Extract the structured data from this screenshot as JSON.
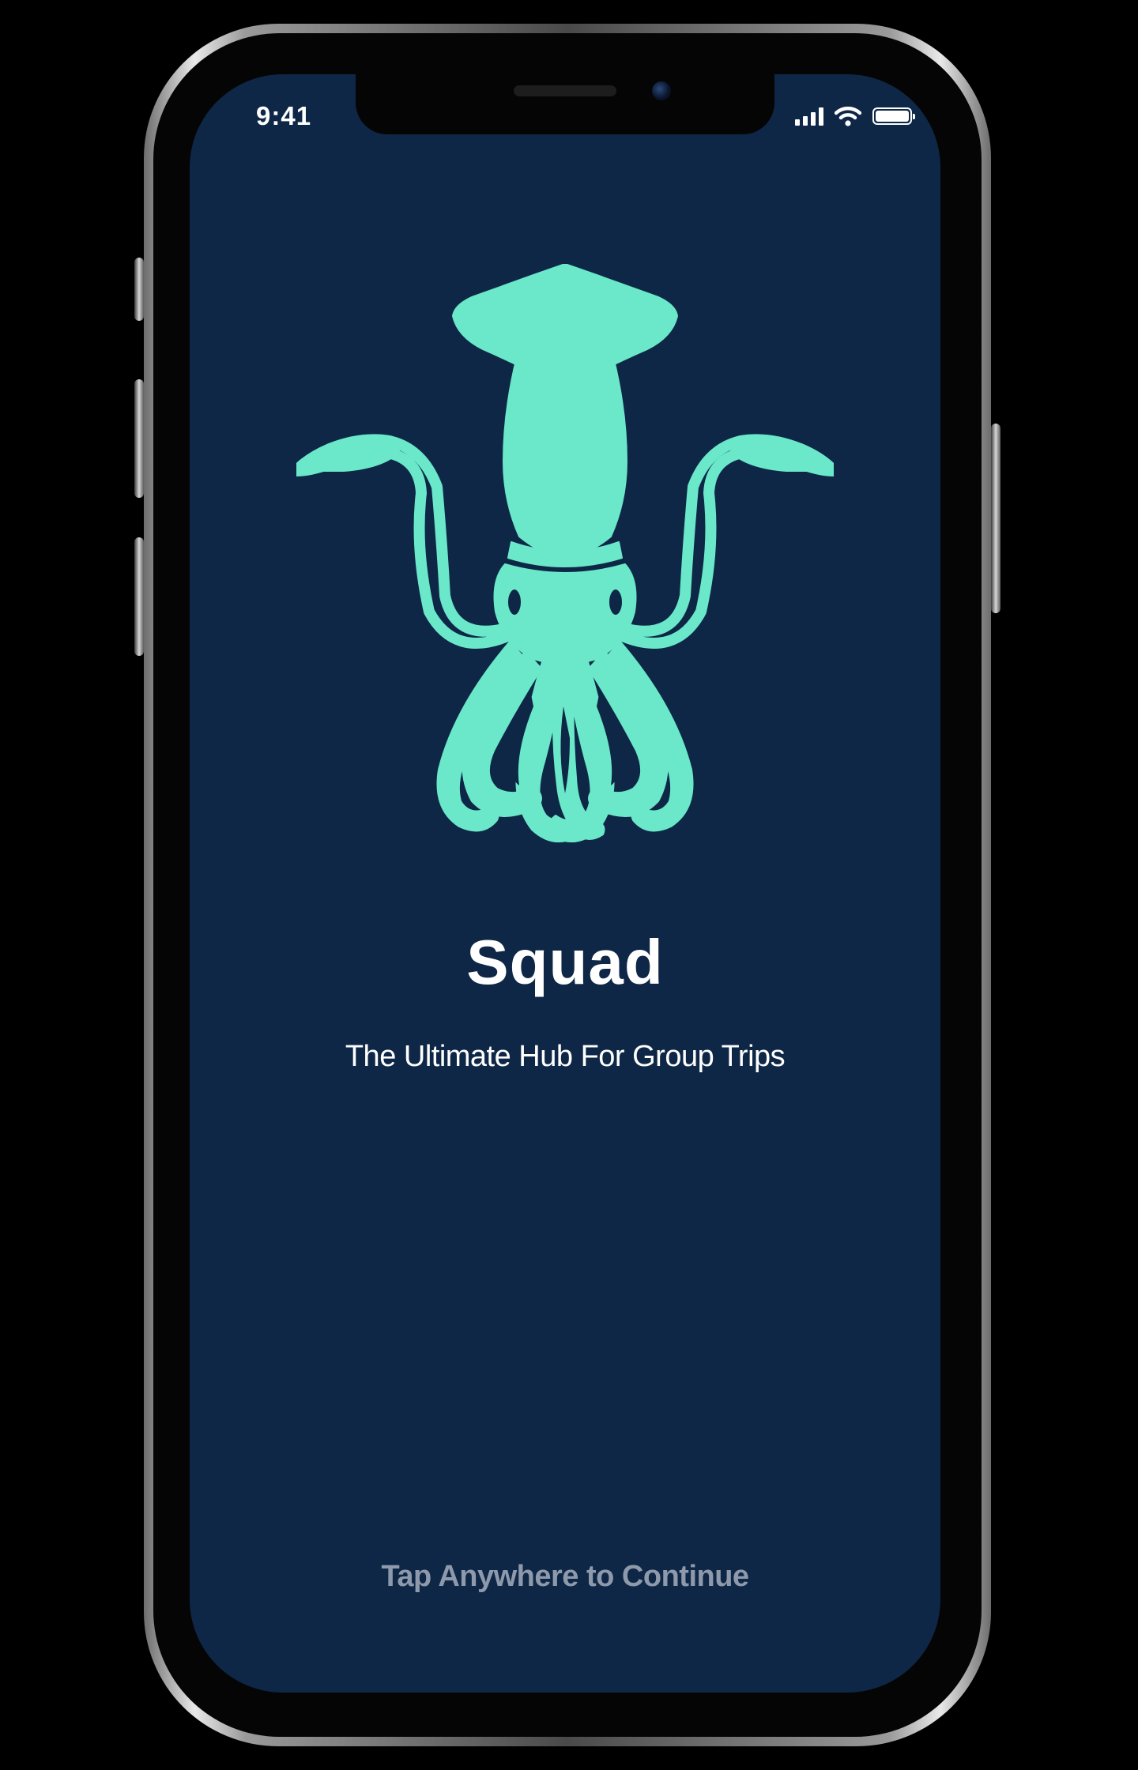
{
  "status_bar": {
    "time": "9:41",
    "signal_bars": 4,
    "battery_level": 1.0
  },
  "app": {
    "title": "Squad",
    "subtitle": "The Ultimate Hub For Group Trips",
    "tap_prompt": "Tap Anywhere to Continue"
  },
  "logo": {
    "icon": "squid-icon",
    "color": "#6ae8c9"
  },
  "theme": {
    "background": "#0e2746",
    "frame_background": "#000000",
    "title_color": "#ffffff",
    "prompt_color": "#8e9aab",
    "accent": "#6ae8c9"
  }
}
